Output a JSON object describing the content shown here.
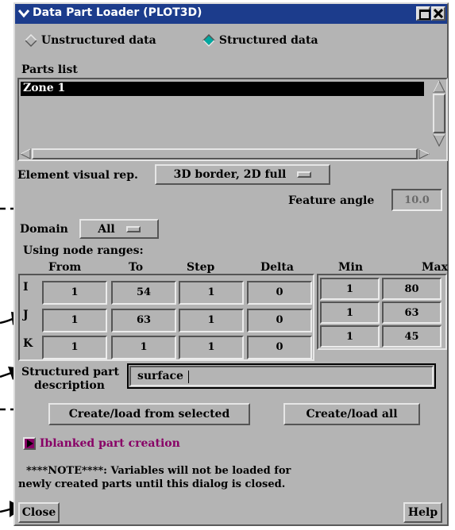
{
  "window": {
    "title": "Data Part Loader (PLOT3D)",
    "data_type_options": [
      {
        "label": "Unstructured data",
        "selected": false
      },
      {
        "label": "Structured data",
        "selected": true
      }
    ],
    "accent_color": "#1c3c8c",
    "selection_color": "#00a8a0",
    "iblank_color": "#880066"
  },
  "parts": {
    "heading": "Parts list",
    "items": [
      "Zone 1"
    ]
  },
  "element_visual": {
    "label": "Element visual rep.",
    "value": "3D border, 2D full"
  },
  "feature_angle": {
    "label": "Feature angle",
    "value": "10.0"
  },
  "domain": {
    "label": "Domain",
    "value": "All"
  },
  "ranges": {
    "heading": "Using node ranges:",
    "columns": [
      "From",
      "To",
      "Step",
      "Delta",
      "Min",
      "Max"
    ],
    "rows": [
      {
        "axis": "I",
        "from": "1",
        "to": "54",
        "step": "1",
        "delta": "0",
        "min": "1",
        "max": "80"
      },
      {
        "axis": "J",
        "from": "1",
        "to": "63",
        "step": "1",
        "delta": "0",
        "min": "1",
        "max": "63"
      },
      {
        "axis": "K",
        "from": "1",
        "to": "1",
        "step": "1",
        "delta": "0",
        "min": "1",
        "max": "45"
      }
    ]
  },
  "description": {
    "label_line1": "Structured part",
    "label_line2": "description",
    "value": "surface"
  },
  "actions": {
    "create_selected": "Create/load from selected",
    "create_all": "Create/load all"
  },
  "iblank": {
    "label": "Iblanked part creation"
  },
  "note": {
    "line1": "****NOTE****: Variables will not be loaded for",
    "line2": "newly created parts until this dialog is closed."
  },
  "footer": {
    "close": "Close",
    "help": "Help"
  }
}
